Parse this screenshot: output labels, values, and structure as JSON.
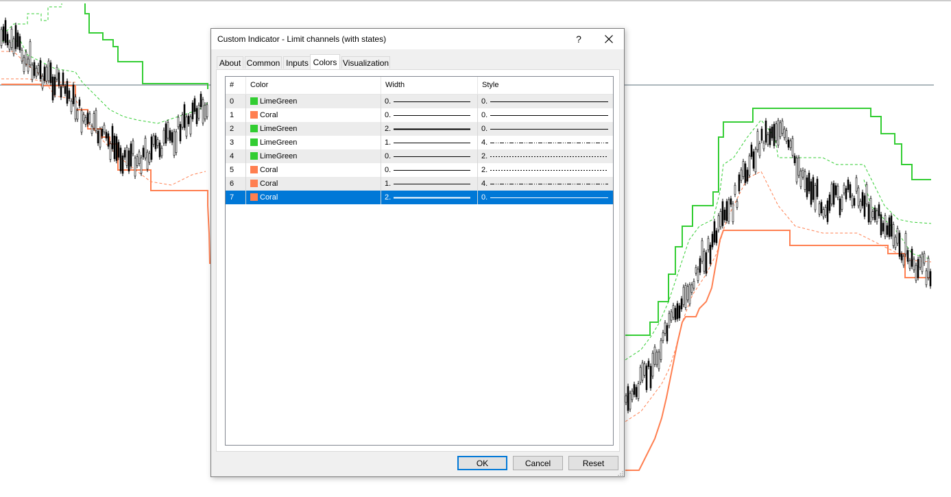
{
  "dialog": {
    "title": "Custom Indicator - Limit channels (with states)",
    "help_label": "?",
    "close_label": "✕"
  },
  "tabs": [
    "About",
    "Common",
    "Inputs",
    "Colors",
    "Visualization"
  ],
  "active_tab": "Colors",
  "table": {
    "headers": [
      "#",
      "Color",
      "Width",
      "Style"
    ],
    "rows": [
      {
        "index": "0",
        "color_name": "LimeGreen",
        "color": "#32cd32",
        "width": "0.",
        "width_value": 0,
        "style": "0.",
        "style_kind": "solid"
      },
      {
        "index": "1",
        "color_name": "Coral",
        "color": "#ff7f50",
        "width": "0.",
        "width_value": 0,
        "style": "0.",
        "style_kind": "solid"
      },
      {
        "index": "2",
        "color_name": "LimeGreen",
        "color": "#32cd32",
        "width": "2.",
        "width_value": 2,
        "style": "0.",
        "style_kind": "solid"
      },
      {
        "index": "3",
        "color_name": "LimeGreen",
        "color": "#32cd32",
        "width": "1.",
        "width_value": 1,
        "style": "4.",
        "style_kind": "dashdotdot"
      },
      {
        "index": "4",
        "color_name": "LimeGreen",
        "color": "#32cd32",
        "width": "0.",
        "width_value": 0,
        "style": "2.",
        "style_kind": "dot"
      },
      {
        "index": "5",
        "color_name": "Coral",
        "color": "#ff7f50",
        "width": "0.",
        "width_value": 0,
        "style": "2.",
        "style_kind": "dot"
      },
      {
        "index": "6",
        "color_name": "Coral",
        "color": "#ff7f50",
        "width": "1.",
        "width_value": 1,
        "style": "4.",
        "style_kind": "dashdotdot"
      },
      {
        "index": "7",
        "color_name": "Coral",
        "color": "#ff7f50",
        "width": "2.",
        "width_value": 2,
        "style": "0.",
        "style_kind": "solid"
      }
    ],
    "selected_row": 7
  },
  "buttons": {
    "ok": "OK",
    "cancel": "Cancel",
    "reset": "Reset"
  },
  "colors": {
    "accent": "#0078d7",
    "lime": "#32cd32",
    "coral": "#ff7f50",
    "candle": "#000000"
  }
}
